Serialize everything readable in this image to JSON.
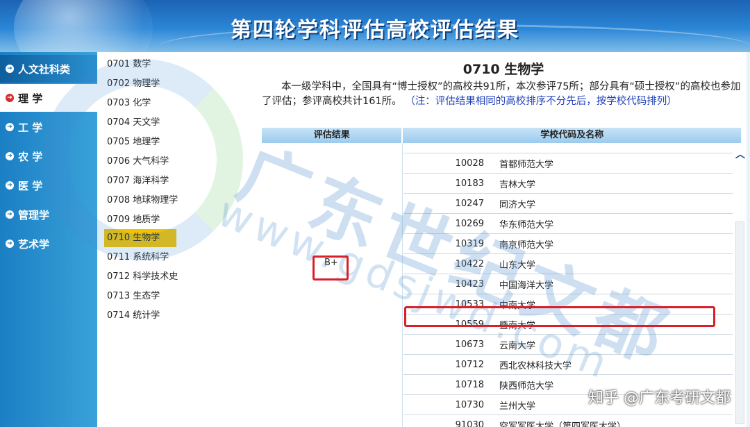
{
  "header": {
    "title": "第四轮学科评估高校评估结果"
  },
  "leftnav": {
    "items": [
      {
        "label": "人文社科类",
        "active": false
      },
      {
        "label": "理 学",
        "active": true
      },
      {
        "label": "工 学",
        "active": false
      },
      {
        "label": "农 学",
        "active": false
      },
      {
        "label": "医 学",
        "active": false
      },
      {
        "label": "管理学",
        "active": false
      },
      {
        "label": "艺术学",
        "active": false
      }
    ]
  },
  "sublist": {
    "items": [
      "0701 数学",
      "0702 物理学",
      "0703 化学",
      "0704 天文学",
      "0705 地理学",
      "0706 大气科学",
      "0707 海洋科学",
      "0708 地球物理学",
      "0709 地质学",
      "0710 生物学",
      "0711 系统科学",
      "0712 科学技术史",
      "0713 生态学",
      "0714 统计学"
    ],
    "selected": "0710 生物学"
  },
  "main": {
    "heading": "0710 生物学",
    "description": "本一级学科中，全国具有“博士授权”的高校共91所，本次参评75所；部分具有“硕士授权”的高校也参加了评估；参评高校共计161所。",
    "note": "（注：评估结果相同的高校排序不分先后，按学校代码排列）",
    "table": {
      "headers": [
        "评估结果",
        "学校代码及名称"
      ],
      "grade": "B+",
      "rows": [
        {
          "code": "10028",
          "name": "首都师范大学"
        },
        {
          "code": "10183",
          "name": "吉林大学"
        },
        {
          "code": "10247",
          "name": "同济大学"
        },
        {
          "code": "10269",
          "name": "华东师范大学"
        },
        {
          "code": "10319",
          "name": "南京师范大学"
        },
        {
          "code": "10422",
          "name": "山东大学"
        },
        {
          "code": "10423",
          "name": "中国海洋大学"
        },
        {
          "code": "10533",
          "name": "中南大学"
        },
        {
          "code": "10559",
          "name": "暨南大学"
        },
        {
          "code": "10673",
          "name": "云南大学"
        },
        {
          "code": "10712",
          "name": "西北农林科技大学"
        },
        {
          "code": "10718",
          "name": "陕西师范大学"
        },
        {
          "code": "10730",
          "name": "兰州大学"
        },
        {
          "code": "91030",
          "name": "空军军医大学（第四军医大学）"
        }
      ],
      "highlighted_code": "10559"
    }
  },
  "watermarks": {
    "large": "广东世纪文都",
    "url": "www.gdsjwd.com",
    "footer": "知乎 @广东考研文都"
  },
  "colors": {
    "highlight": "#d9202a",
    "selected": "#f2c200",
    "nav": "#1b7fc4",
    "note": "#1f3fb8"
  }
}
